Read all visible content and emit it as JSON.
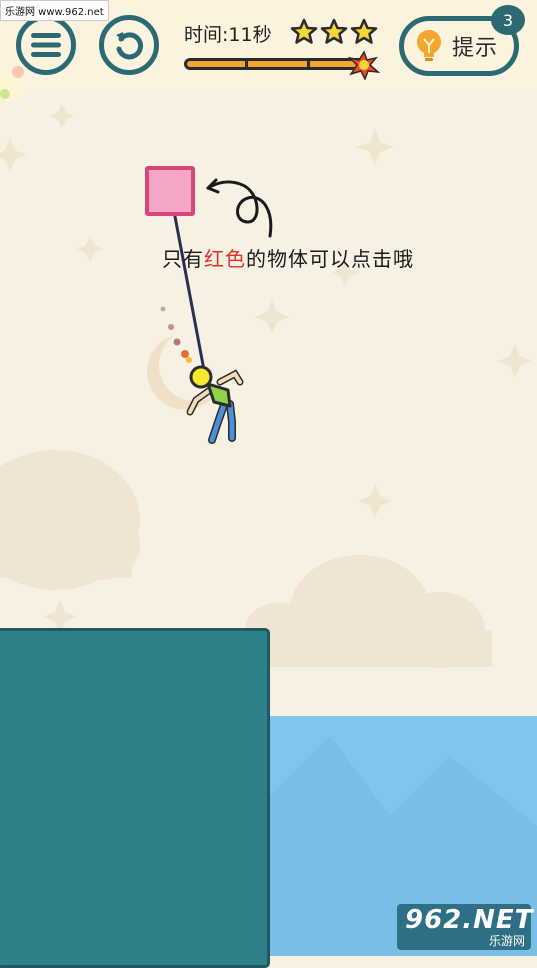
{
  "watermark_top": "乐游网 www.962.net",
  "hud": {
    "timer_text": "时间:11秒",
    "stars": 3,
    "hint_label": "提示",
    "hint_count": "3"
  },
  "level": {
    "hint_part1": "只有",
    "hint_red": "红色",
    "hint_part2": "的物体可以点击哦"
  },
  "watermark_bottom": {
    "brand": "962.NET",
    "site": "乐游网"
  },
  "colors": {
    "accent": "#2c6a73",
    "block_fill": "#f5a6c6",
    "block_border": "#d9447a",
    "water": "#7fc5ec",
    "platform": "#2f8189",
    "highlight_text": "#e0302c"
  }
}
